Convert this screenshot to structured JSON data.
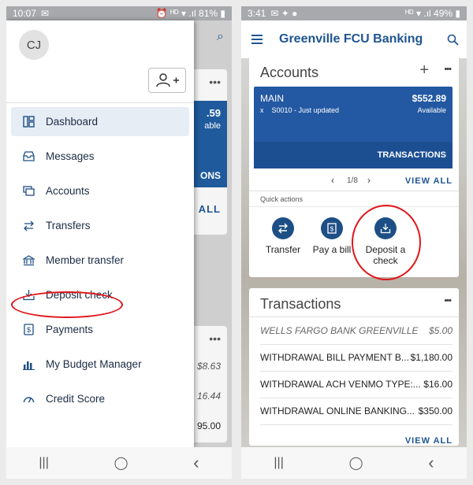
{
  "left": {
    "status": {
      "time": "10:07",
      "right": "⏰ ᴴᴰ ▾ .ıl 81% ▮"
    },
    "drawer": {
      "initials": "CJ",
      "items": [
        {
          "label": "Dashboard",
          "icon": "dashboard-icon"
        },
        {
          "label": "Messages",
          "icon": "messages-icon"
        },
        {
          "label": "Accounts",
          "icon": "accounts-icon"
        },
        {
          "label": "Transfers",
          "icon": "transfers-icon"
        },
        {
          "label": "Member transfer",
          "icon": "bank-icon"
        },
        {
          "label": "Deposit check",
          "icon": "deposit-icon"
        },
        {
          "label": "Payments",
          "icon": "payments-icon"
        },
        {
          "label": "My Budget Manager",
          "icon": "budget-icon"
        },
        {
          "label": "Credit Score",
          "icon": "gauge-icon"
        }
      ]
    },
    "background": {
      "amount": ".59",
      "available": "able",
      "transactions": "ONS",
      "view_all": "ALL",
      "amounts": [
        "$8.63",
        "16.44",
        "95.00"
      ]
    }
  },
  "right": {
    "status": {
      "time": "3:41",
      "right": "ᴴᴰ ▾ .ıl 49% ▮"
    },
    "app_title": "Greenville FCU Banking",
    "accounts": {
      "title": "Accounts",
      "name": "MAIN",
      "number": "x    S0010 - Just updated",
      "balance": "$552.89",
      "available": "Available",
      "transactions_btn": "TRANSACTIONS",
      "pager": "1/8",
      "view_all": "VIEW ALL",
      "quick_actions_label": "Quick actions",
      "quick_actions": [
        {
          "label": "Transfer",
          "icon": "transfer-icon"
        },
        {
          "label": "Pay a bill",
          "icon": "bill-icon"
        },
        {
          "label": "Deposit a check",
          "icon": "deposit-icon"
        }
      ]
    },
    "transactions": {
      "title": "Transactions",
      "rows": [
        {
          "desc": "WELLS FARGO BANK GREENVILLE",
          "amount": "$5.00",
          "pending": true
        },
        {
          "desc": "WITHDRAWAL BILL PAYMENT B...",
          "amount": "$1,180.00",
          "pending": false
        },
        {
          "desc": "WITHDRAWAL ACH VENMO TYPE:...",
          "amount": "$16.00",
          "pending": false
        },
        {
          "desc": "WITHDRAWAL ONLINE BANKING...",
          "amount": "$350.00",
          "pending": false
        }
      ],
      "view_all": "VIEW ALL"
    }
  },
  "nav": {
    "recent": "|||",
    "home": "◯",
    "back": "‹"
  },
  "colors": {
    "brand_blue": "#1f5592",
    "highlight_red": "#e0161a"
  }
}
